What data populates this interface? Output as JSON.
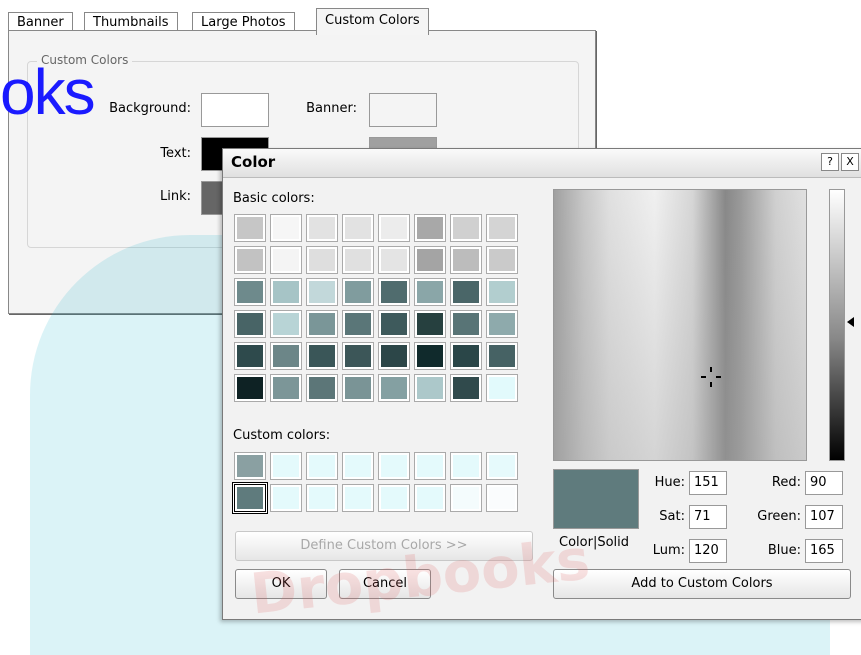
{
  "tabs": [
    {
      "label": "Banner"
    },
    {
      "label": "Thumbnails"
    },
    {
      "label": "Large Photos"
    },
    {
      "label": "Custom Colors"
    }
  ],
  "panel": {
    "group_title": "Custom Colors",
    "background_label": "Background:",
    "banner_label": "Banner:",
    "text_label": "Text:",
    "link_label": "Link:"
  },
  "overlay_text": "oks",
  "watermark_text": "Dropbooks",
  "color_dialog": {
    "title": "Color",
    "help_btn": "?",
    "close_btn": "X",
    "basic_colors_label": "Basic colors:",
    "custom_colors_label": "Custom colors:",
    "define_button": "Define Custom Colors >>",
    "ok_button": "OK",
    "cancel_button": "Cancel",
    "color_solid_label": "Color|Solid",
    "hue_label": "Hue:",
    "hue": "151",
    "sat_label": "Sat:",
    "sat": "71",
    "lum_label": "Lum:",
    "lum": "120",
    "red_label": "Red:",
    "red": "90",
    "green_label": "Green:",
    "green": "107",
    "blue_label": "Blue:",
    "blue": "165",
    "add_button": "Add to Custom Colors",
    "preview_color": "#5f7b7d",
    "basic_colors": [
      [
        "#c6c6c6",
        "#f6f6f6",
        "#e2e2e2",
        "#e2e2e2",
        "#ececec",
        "#a8a8a8",
        "#d0d0d0",
        "#d4d4d4"
      ],
      [
        "#c2c2c2",
        "#f4f4f4",
        "#dedede",
        "#e0e0e0",
        "#e4e4e4",
        "#a4a4a4",
        "#bcbcbc",
        "#cacaca"
      ],
      [
        "#6e8a8c",
        "#a6c4c6",
        "#c2d8da",
        "#809c9e",
        "#506c6e",
        "#8aa6a8",
        "#4a6668",
        "#b2cecf"
      ],
      [
        "#486466",
        "#b8d4d6",
        "#7a9698",
        "#5a7678",
        "#3e5a5c",
        "#26403f",
        "#587476",
        "#8eaaac"
      ],
      [
        "#2e4a4c",
        "#6c8688",
        "#3a5658",
        "#3c5658",
        "#2c4648",
        "#102a2c",
        "#2a4648",
        "#466264"
      ],
      [
        "#0e2224",
        "#7c9698",
        "#5c7678",
        "#7a9496",
        "#84a0a2",
        "#acc8ca",
        "#304a4c",
        "#e2fafc"
      ]
    ],
    "custom_colors": [
      [
        "#8aa0a2",
        "#e4fafc",
        "#e4fafc",
        "#e4fafc",
        "#e4fafc",
        "#e4fafc",
        "#e4fafc",
        "#e6fafc"
      ],
      [
        "#5f7b7d",
        "#e4fafc",
        "#e4fafc",
        "#e4fafc",
        "#e4fafc",
        "#e4fafc",
        "#f4fcfd",
        "#fafcfd"
      ]
    ]
  },
  "swatches": {
    "background": "#ffffff",
    "banner": "#f4f4f4",
    "text": "#000000",
    "link": "#666666",
    "banner2": "#a0a0a0"
  }
}
